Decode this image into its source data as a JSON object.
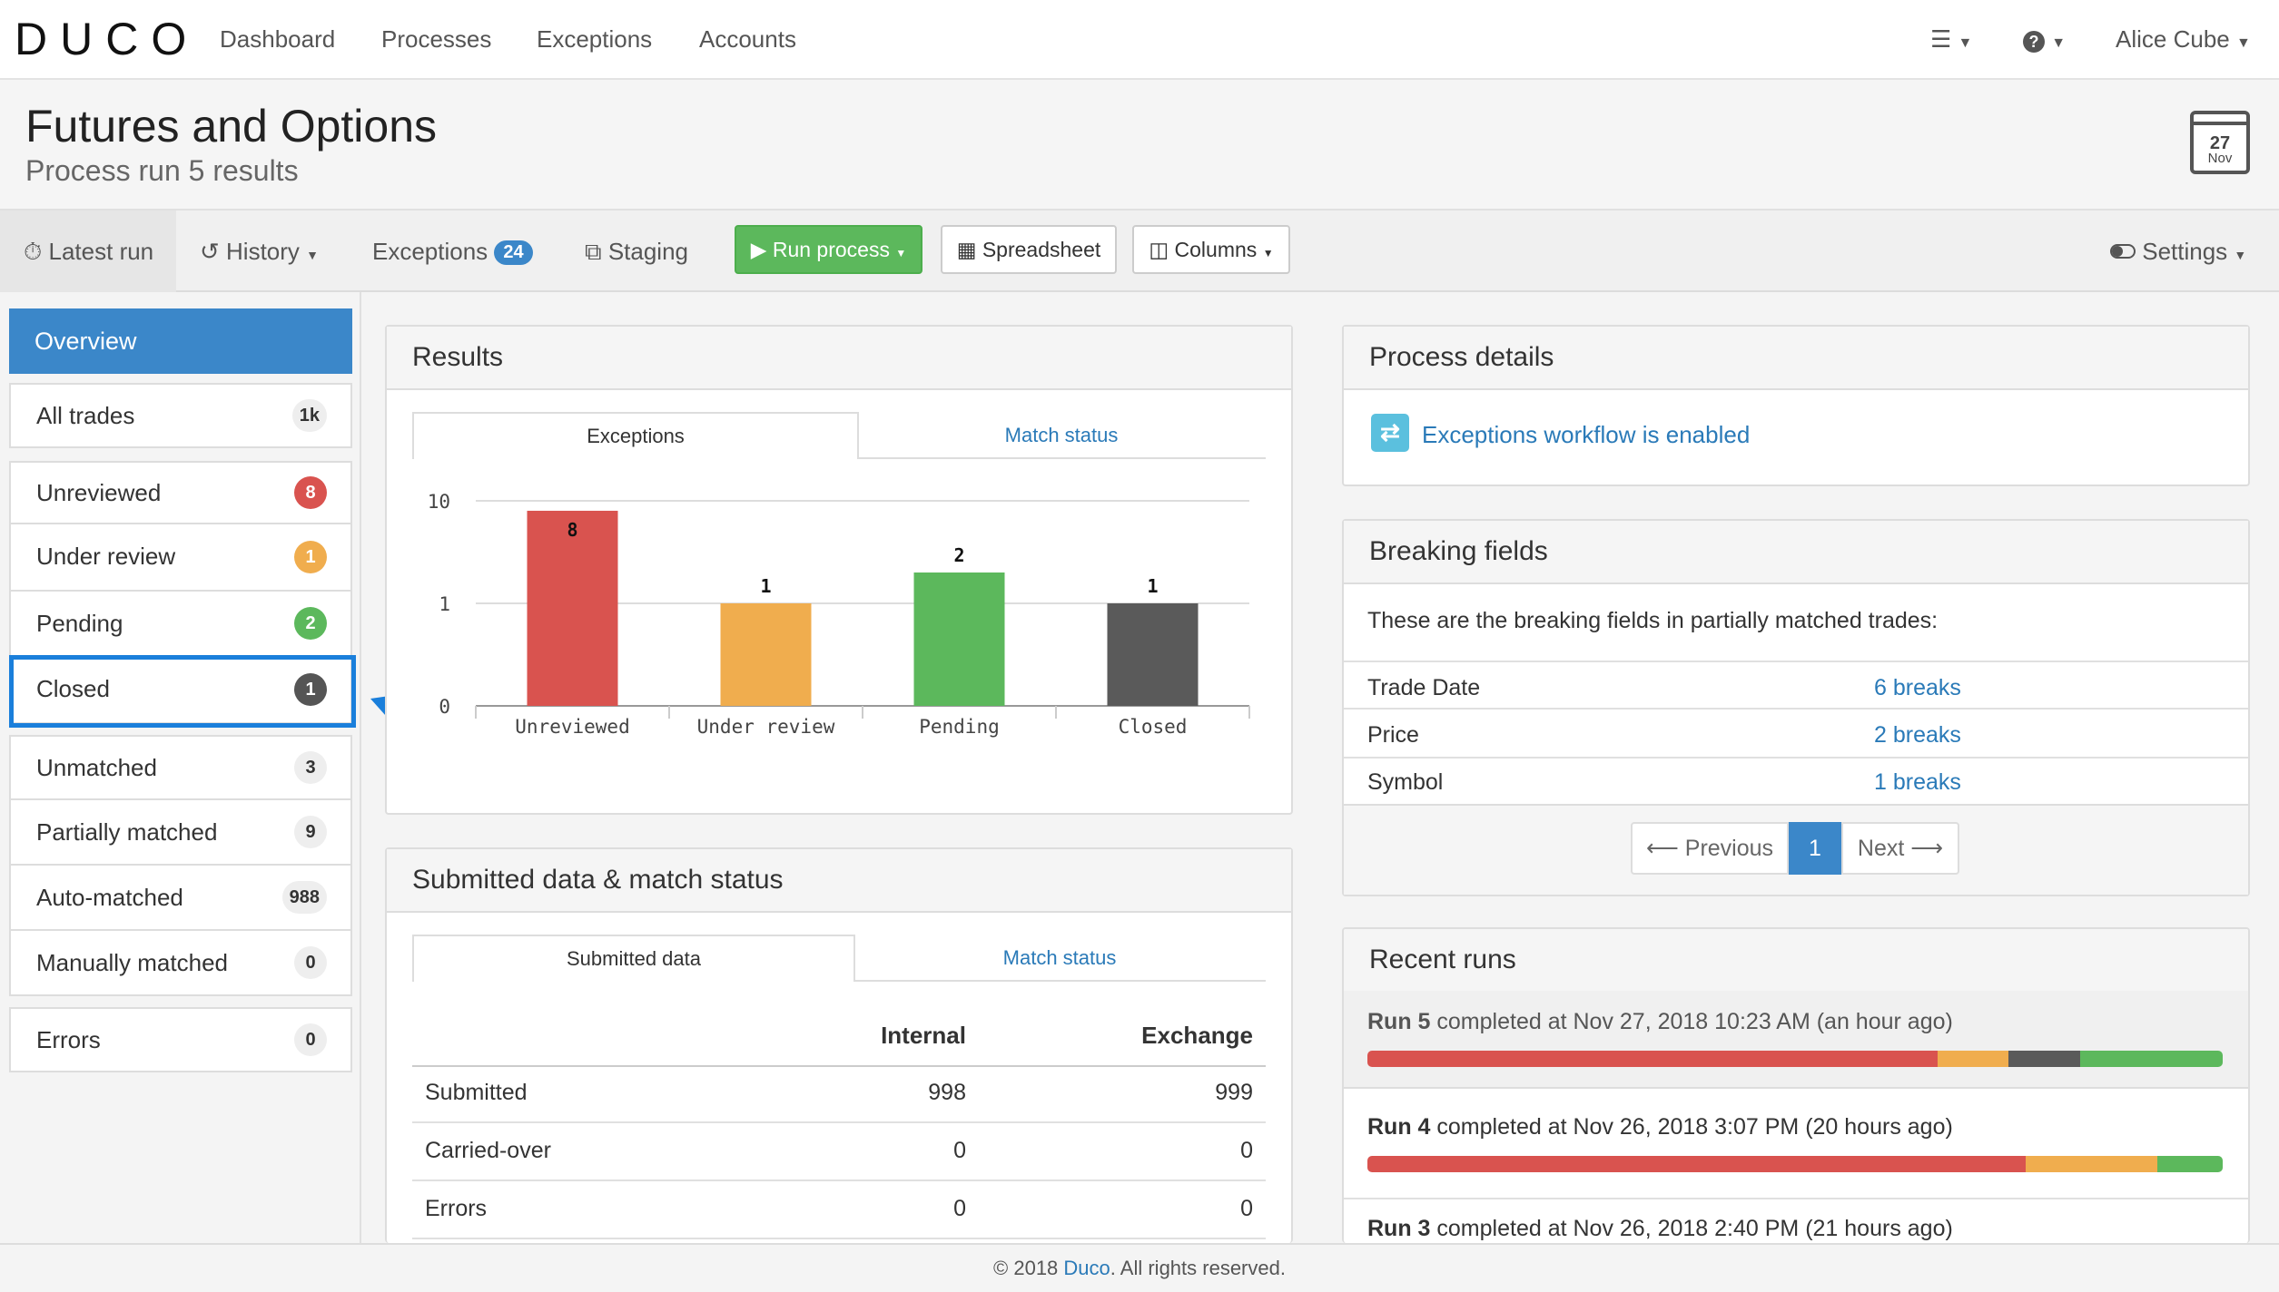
{
  "topnav": {
    "logo": "DUCO",
    "links": [
      "Dashboard",
      "Processes",
      "Exceptions",
      "Accounts"
    ],
    "user": "Alice Cube"
  },
  "header": {
    "title": "Futures and Options",
    "subtitle": "Process run 5 results",
    "calendar_day": "27",
    "calendar_month": "Nov"
  },
  "toolbar": {
    "latest_run": "Latest run",
    "history": "History",
    "exceptions": "Exceptions",
    "exceptions_count": "24",
    "staging": "Staging",
    "run_process": "Run process",
    "spreadsheet": "Spreadsheet",
    "columns": "Columns",
    "settings": "Settings"
  },
  "sidebar": {
    "overview": "Overview",
    "items": [
      {
        "label": "All trades",
        "count": "1k"
      },
      {
        "label": "Unreviewed",
        "count": "8"
      },
      {
        "label": "Under review",
        "count": "1"
      },
      {
        "label": "Pending",
        "count": "2"
      },
      {
        "label": "Closed",
        "count": "1"
      },
      {
        "label": "Unmatched",
        "count": "3"
      },
      {
        "label": "Partially matched",
        "count": "9"
      },
      {
        "label": "Auto-matched",
        "count": "988"
      },
      {
        "label": "Manually matched",
        "count": "0"
      },
      {
        "label": "Errors",
        "count": "0"
      }
    ]
  },
  "results": {
    "title": "Results",
    "tab_exceptions": "Exceptions",
    "tab_match_status": "Match status"
  },
  "chart_data": {
    "type": "bar",
    "categories": [
      "Unreviewed",
      "Under review",
      "Pending",
      "Closed"
    ],
    "values": [
      8,
      1,
      2,
      1
    ],
    "yscale": "log",
    "yticks": [
      "10",
      "1",
      "0"
    ],
    "colors": [
      "#d9534f",
      "#f0ad4e",
      "#5cb85c",
      "#5a5a5a"
    ],
    "grid": true
  },
  "submitted": {
    "title": "Submitted data & match status",
    "tab_submitted": "Submitted data",
    "tab_match_status": "Match status",
    "col_internal": "Internal",
    "col_exchange": "Exchange",
    "rows": [
      {
        "label": "Submitted",
        "internal": "998",
        "exchange": "999"
      },
      {
        "label": "Carried-over",
        "internal": "0",
        "exchange": "0"
      },
      {
        "label": "Errors",
        "internal": "0",
        "exchange": "0"
      }
    ]
  },
  "process_details": {
    "title": "Process details",
    "workflow": "Exceptions workflow is enabled"
  },
  "breaking_fields": {
    "title": "Breaking fields",
    "intro": "These are the breaking fields in partially matched trades:",
    "rows": [
      {
        "field": "Trade Date",
        "breaks": "6 breaks"
      },
      {
        "field": "Price",
        "breaks": "2 breaks"
      },
      {
        "field": "Symbol",
        "breaks": "1 breaks"
      }
    ],
    "prev": "Previous",
    "page": "1",
    "next": "Next"
  },
  "recent_runs": {
    "title": "Recent runs",
    "runs": [
      {
        "run": "Run 5",
        "text": "completed at Nov 27, 2018 10:23 AM (an hour ago)",
        "segments": [
          0.667,
          0.083,
          0.083,
          0.167
        ]
      },
      {
        "run": "Run 4",
        "text": "completed at Nov 26, 2018 3:07 PM (20 hours ago)",
        "segments": [
          0.77,
          0.154,
          0.0,
          0.076
        ]
      },
      {
        "run": "Run 3",
        "text": "completed at Nov 26, 2018 2:40 PM (21 hours ago)"
      }
    ],
    "segment_colors": [
      "#d9534f",
      "#f0ad4e",
      "#5a5a5a",
      "#5cb85c"
    ]
  },
  "footer": {
    "prefix": "© 2018",
    "brand": "Duco",
    "suffix": ". All rights reserved."
  }
}
